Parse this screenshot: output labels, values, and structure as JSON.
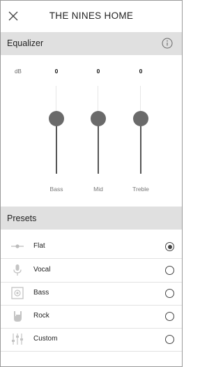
{
  "header": {
    "title": "THE NINES HOME",
    "close_icon": "close-icon"
  },
  "equalizer": {
    "section_label": "Equalizer",
    "info_icon": "info-icon",
    "unit_label": "dB",
    "bands": [
      {
        "name": "Bass",
        "value": "0"
      },
      {
        "name": "Mid",
        "value": "0"
      },
      {
        "name": "Treble",
        "value": "0"
      }
    ]
  },
  "presets": {
    "section_label": "Presets",
    "items": [
      {
        "label": "Flat",
        "icon": "flat-icon",
        "selected": true
      },
      {
        "label": "Vocal",
        "icon": "microphone-icon",
        "selected": false
      },
      {
        "label": "Bass",
        "icon": "speaker-icon",
        "selected": false
      },
      {
        "label": "Rock",
        "icon": "rock-hand-icon",
        "selected": false
      },
      {
        "label": "Custom",
        "icon": "sliders-icon",
        "selected": false
      }
    ]
  }
}
